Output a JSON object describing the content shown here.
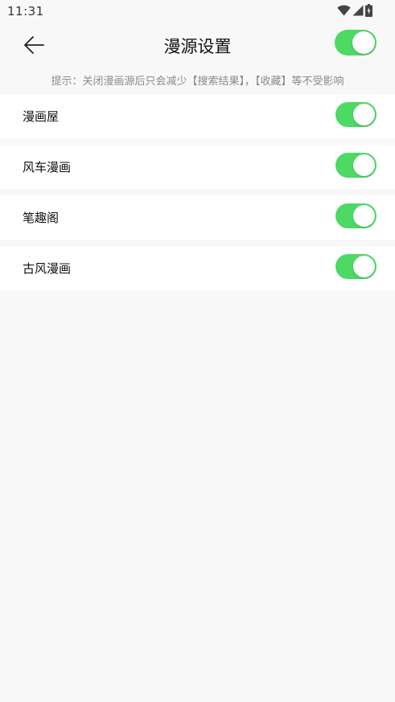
{
  "status_bar": {
    "time": "11:31",
    "icons": [
      "wifi-icon",
      "cellular-signal-icon",
      "battery-charging-icon"
    ]
  },
  "header": {
    "back_icon": "arrow-left-icon",
    "title": "漫源设置",
    "master_toggle_on": true
  },
  "hint": "提示：关闭漫画源后只会减少【搜索结果】，【收藏】等不受影响",
  "sources": [
    {
      "label": "漫画屋",
      "enabled": true
    },
    {
      "label": "风车漫画",
      "enabled": true
    },
    {
      "label": "笔趣阁",
      "enabled": true
    },
    {
      "label": "古风漫画",
      "enabled": true
    }
  ],
  "colors": {
    "toggle_on": "#4cd964",
    "background": "#f8f8f8",
    "row_background": "#ffffff",
    "hint_text": "#8a8a8a"
  }
}
